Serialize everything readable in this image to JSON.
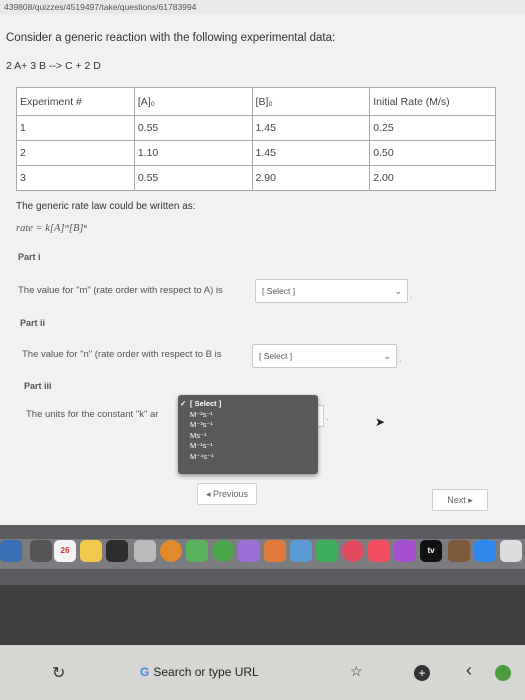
{
  "browser": {
    "url_fragment": "439808/quizzes/4519497/take/questions/61783994",
    "url_placeholder": "Search or type URL",
    "search_engine_glyph": "G",
    "reload_glyph": "↻",
    "bookmark_glyph": "☆",
    "add_glyph": "+",
    "back_glyph": "‹",
    "extra_glyph": "●"
  },
  "question": {
    "intro": "Consider a generic reaction with the following experimental data:",
    "reaction": "2 A+  3 B --> C + 2 D",
    "rate_law_intro": "The generic rate law could be written as:",
    "rate_law": "rate  =  k[A]ᵐ[B]ⁿ"
  },
  "table": {
    "headers": [
      "Experiment #",
      "[A]₀",
      "[B]₀",
      "Initial Rate (M/s)"
    ],
    "rows": [
      [
        "1",
        "0.55",
        "1.45",
        "0.25"
      ],
      [
        "2",
        "1.10",
        "1.45",
        "0.50"
      ],
      [
        "3",
        "0.55",
        "2.90",
        "2.00"
      ]
    ]
  },
  "parts": [
    {
      "label": "Part i",
      "text": "The value for \"m\" (rate order with respect to A) is",
      "select": "[ Select ]"
    },
    {
      "label": "Part ii",
      "text": "The value for \"n\" (rate order with respect to B is",
      "select": "[ Select ]"
    },
    {
      "label": "Part iii",
      "text": "The units for the constant \"k\" ar",
      "select": "[ Select ]"
    }
  ],
  "dropdown": {
    "check": "✓",
    "options": [
      "[ Select ]",
      "M⁻²s⁻¹",
      "M⁻³s⁻¹",
      "Ms⁻¹",
      "M⁻¹s⁻¹",
      "M⁻⁴s⁻¹"
    ]
  },
  "nav": {
    "previous": "◂ Previous",
    "next": "Next ▸"
  },
  "dock": {
    "calendar_day": "26",
    "tv_label": "tv"
  }
}
